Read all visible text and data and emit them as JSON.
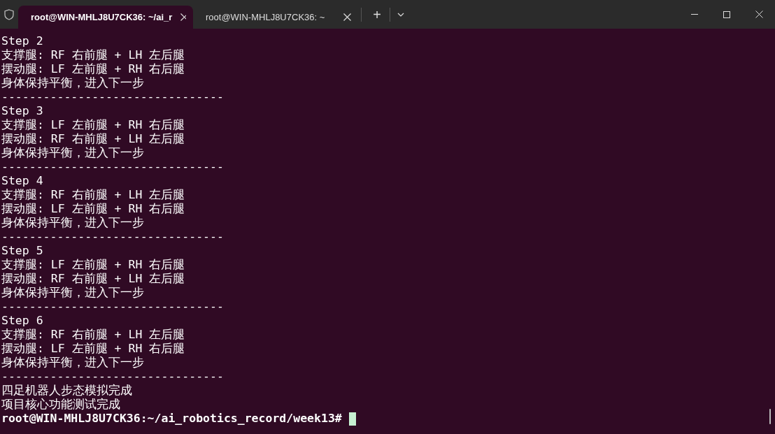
{
  "tabs": [
    {
      "title": "root@WIN-MHLJ8U7CK36: ~/ai_r",
      "selected": true
    },
    {
      "title": "root@WIN-MHLJ8U7CK36: ~",
      "selected": false
    }
  ],
  "new_tab": "+",
  "lines": [
    "Step 2",
    "支撑腿: RF 右前腿 + LH 左后腿",
    "摆动腿: LF 左前腿 + RH 右后腿",
    "身体保持平衡，进入下一步",
    "--------------------------------",
    "Step 3",
    "支撑腿: LF 左前腿 + RH 右后腿",
    "摆动腿: RF 右前腿 + LH 左后腿",
    "身体保持平衡，进入下一步",
    "--------------------------------",
    "Step 4",
    "支撑腿: RF 右前腿 + LH 左后腿",
    "摆动腿: LF 左前腿 + RH 右后腿",
    "身体保持平衡，进入下一步",
    "--------------------------------",
    "Step 5",
    "支撑腿: LF 左前腿 + RH 右后腿",
    "摆动腿: RF 右前腿 + LH 左后腿",
    "身体保持平衡，进入下一步",
    "--------------------------------",
    "Step 6",
    "支撑腿: RF 右前腿 + LH 左后腿",
    "摆动腿: LF 左前腿 + RH 右后腿",
    "身体保持平衡，进入下一步",
    "--------------------------------",
    "四足机器人步态模拟完成",
    "项目核心功能测试完成"
  ],
  "prompt": "root@WIN-MHLJ8U7CK36:~/ai_robotics_record/week13#"
}
